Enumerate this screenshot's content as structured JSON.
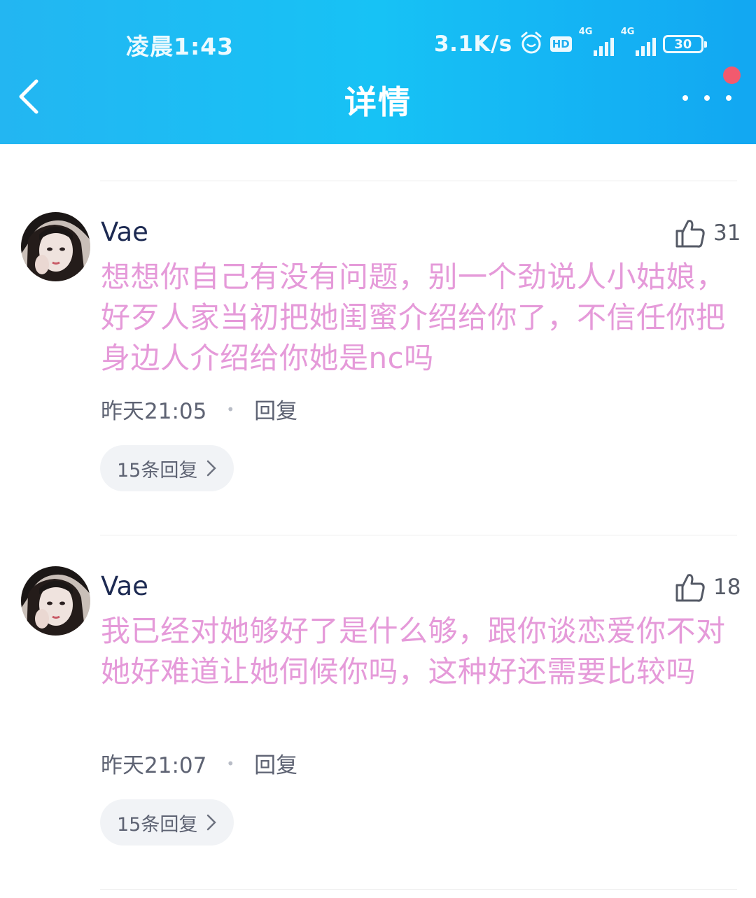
{
  "status_bar": {
    "time": "凌晨1:43",
    "net_speed": "3.1K/s",
    "hd": "HD",
    "signal1": "4G",
    "signal2": "4G",
    "battery": "30"
  },
  "header": {
    "title": "详情"
  },
  "comments": [
    {
      "username": "Vae",
      "likes": "31",
      "text": "想想你自己有没有问题，别一个劲说人小姑娘，好歹人家当初把她闺蜜介绍给你了，不信任你把身边人介绍给你她是nc吗",
      "time": "昨天21:05",
      "reply_label": "回复",
      "replies_label": "15条回复"
    },
    {
      "username": "Vae",
      "likes": "18",
      "text": "我已经对她够好了是什么够，跟你谈恋爱你不对她好难道让她伺候你吗，这种好还需要比较吗",
      "time": "昨天21:07",
      "reply_label": "回复",
      "replies_label": "15条回复"
    }
  ],
  "colors": {
    "header_gradient_start": "#23b6f2",
    "header_gradient_end": "#12a7f2",
    "comment_text": "#e59ad9",
    "username": "#1d2a52",
    "notify_dot": "#f25a6e"
  },
  "icons": [
    "back-icon",
    "more-icon",
    "thumbs-up-icon",
    "chevron-right-icon",
    "alarm-icon"
  ]
}
